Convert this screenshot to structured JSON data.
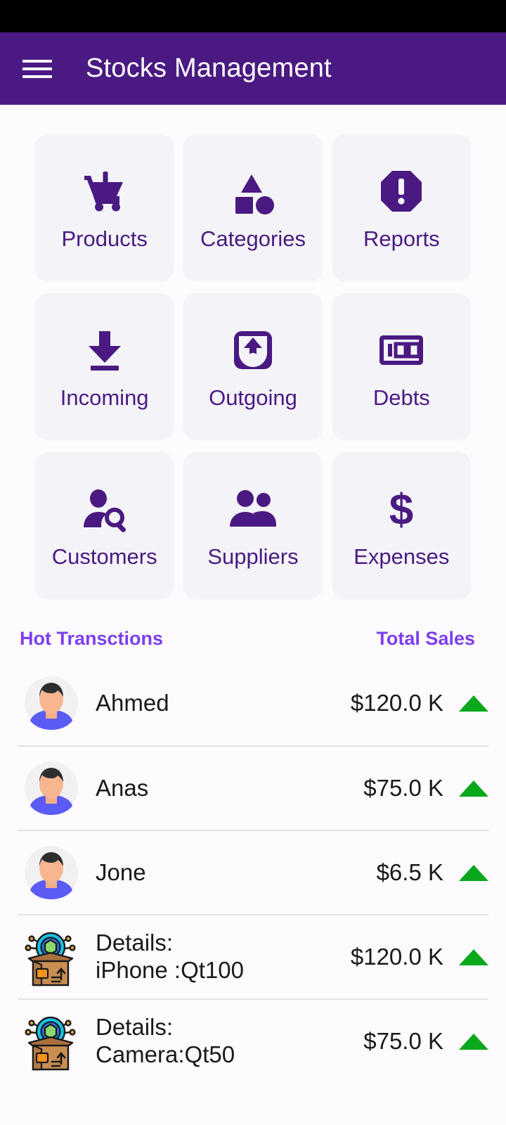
{
  "app": {
    "title": "Stocks Management",
    "menu_icon": "hamburger-menu-icon",
    "appbar_color": "#4A1A82",
    "page_background": "#FDFBFE",
    "tile_background": "#F4F4F8",
    "accent_color": "#7C3FEF",
    "trend_up_color": "#0AA81C"
  },
  "grid": {
    "tiles": [
      {
        "label": "Products",
        "icon": "shopping-cart-alert-icon"
      },
      {
        "label": "Categories",
        "icon": "shapes-category-icon"
      },
      {
        "label": "Reports",
        "icon": "octagon-alert-icon"
      },
      {
        "label": "Incoming",
        "icon": "download-arrow-icon"
      },
      {
        "label": "Outgoing",
        "icon": "upload-box-arrow-icon"
      },
      {
        "label": "Debts",
        "icon": "banknote-100-icon"
      },
      {
        "label": "Customers",
        "icon": "person-search-icon"
      },
      {
        "label": "Suppliers",
        "icon": "people-group-icon"
      },
      {
        "label": "Expenses",
        "icon": "dollar-sign-icon"
      }
    ]
  },
  "sections": {
    "hot_transactions_label": "Hot Transctions",
    "total_sales_label": "Total Sales"
  },
  "transactions": [
    {
      "name": "Ahmed",
      "amount": "$120.0 K",
      "trend": "up",
      "icon": "avatar-person-icon"
    },
    {
      "name": "Anas",
      "amount": "$75.0 K",
      "trend": "up",
      "icon": "avatar-person-icon"
    },
    {
      "name": "Jone",
      "amount": "$6.5 K",
      "trend": "up",
      "icon": "avatar-person-icon"
    },
    {
      "name": "Details:\niPhone :Qt100",
      "amount": "$120.0 K",
      "trend": "up",
      "icon": "open-box-product-icon"
    },
    {
      "name": "Details:\nCamera:Qt50",
      "amount": "$75.0 K",
      "trend": "up",
      "icon": "open-box-product-icon"
    }
  ]
}
